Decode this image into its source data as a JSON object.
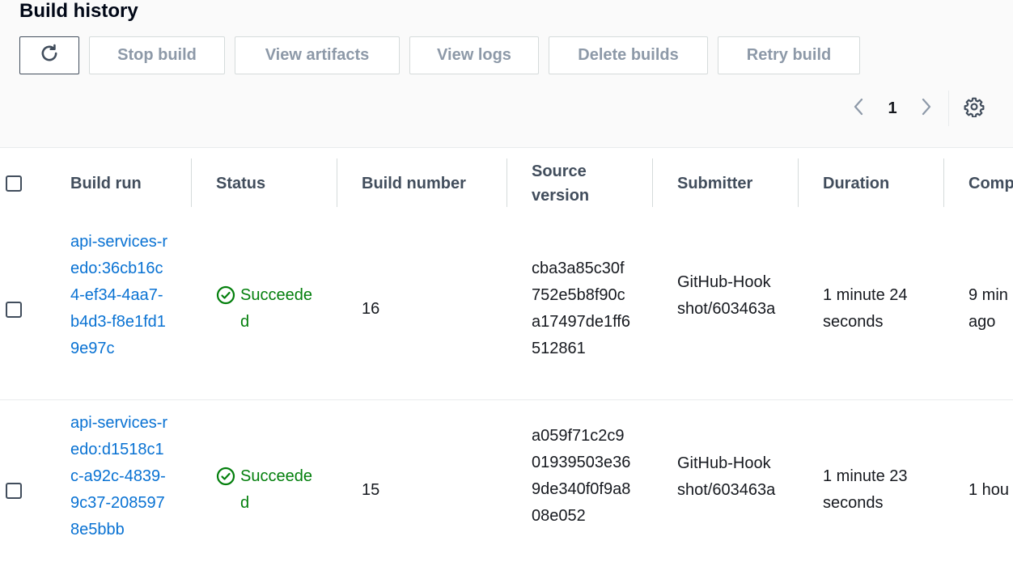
{
  "page": {
    "title": "Build history"
  },
  "toolbar": {
    "stop": "Stop build",
    "artifacts": "View artifacts",
    "logs": "View logs",
    "delete": "Delete builds",
    "retry": "Retry build"
  },
  "pagination": {
    "current": "1"
  },
  "table": {
    "headers": {
      "build_run": "Build run",
      "status": "Status",
      "build_number": "Build number",
      "source_version": "Source version",
      "submitter": "Submitter",
      "duration": "Duration",
      "completed": "Comp"
    },
    "rows": [
      {
        "build_run": "api-services-redo:36cb16c4-ef34-4aa7-b4d3-f8e1fd19e97c",
        "status": "Succeeded",
        "build_number": "16",
        "source_version": "cba3a85c30f752e5b8f90ca17497de1ff6512861",
        "submitter": "GitHub-Hookshot/603463a",
        "duration": "1 minute 24 seconds",
        "completed": "9 min ago"
      },
      {
        "build_run": "api-services-redo:d1518c1c-a92c-4839-9c37-2085978e5bbb",
        "status": "Succeeded",
        "build_number": "15",
        "source_version": "a059f71c2c901939503e369de340f0f9a808e052",
        "submitter": "GitHub-Hookshot/603463a",
        "duration": "1 minute 23 seconds",
        "completed": "1 hou"
      }
    ]
  },
  "colors": {
    "link": "#0972d3",
    "success": "#037f0c",
    "header_text": "#414d5c"
  },
  "icons": [
    "refresh-icon",
    "chevron-left-icon",
    "chevron-right-icon",
    "settings-icon",
    "check-circle-icon"
  ]
}
